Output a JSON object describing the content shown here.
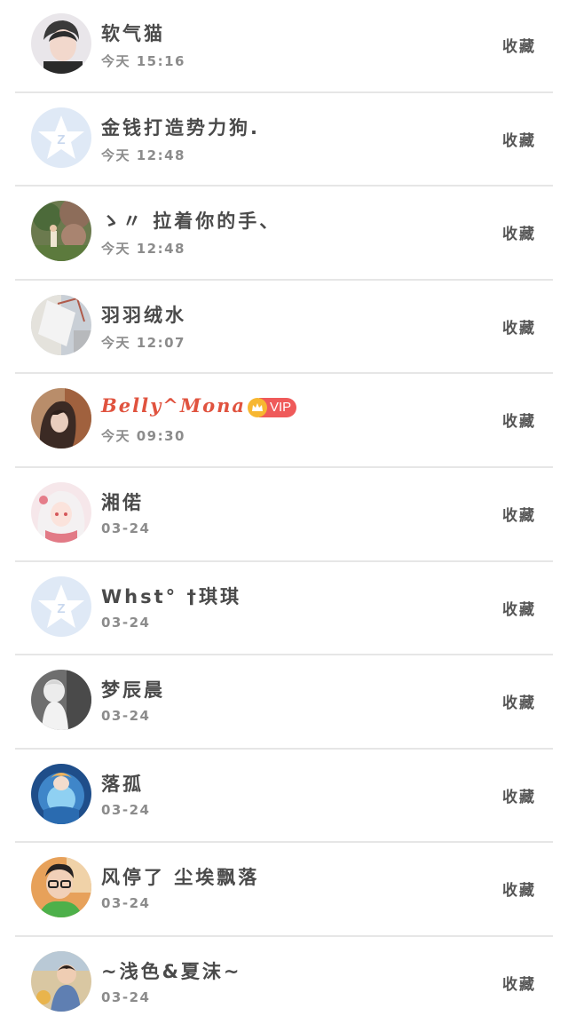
{
  "contacts": [
    {
      "name": "软气猫",
      "time": "今天 15:16",
      "action": "收藏",
      "avatar": "photo-male-portrait",
      "vip": false
    },
    {
      "name": "金钱打造势力狗.",
      "time": "今天 12:48",
      "action": "收藏",
      "avatar": "default-qq-star",
      "vip": false
    },
    {
      "name": "ゝ〃 拉着你的手、",
      "time": "今天 12:48",
      "action": "收藏",
      "avatar": "photo-garden-child",
      "vip": false
    },
    {
      "name": "羽羽绒水",
      "time": "今天 12:07",
      "action": "收藏",
      "avatar": "photo-room-window",
      "vip": false
    },
    {
      "name": "Belly^Mona",
      "time": "今天 09:30",
      "action": "收藏",
      "avatar": "photo-girl-dark-hair",
      "vip": true,
      "vip_label": "VIP"
    },
    {
      "name": "湘偌",
      "time": "03-24",
      "action": "收藏",
      "avatar": "anime-girl-white-hair",
      "vip": false
    },
    {
      "name": "Whst° †琪琪",
      "time": "03-24",
      "action": "收藏",
      "avatar": "default-qq-star",
      "vip": false
    },
    {
      "name": "梦辰晨",
      "time": "03-24",
      "action": "收藏",
      "avatar": "photo-bw-figure",
      "vip": false
    },
    {
      "name": "落孤",
      "time": "03-24",
      "action": "收藏",
      "avatar": "anime-blue-fantasy",
      "vip": false
    },
    {
      "name": "风停了 尘埃飘落",
      "time": "03-24",
      "action": "收藏",
      "avatar": "photo-boy-glasses",
      "vip": false
    },
    {
      "name": "~浅色&夏沫~",
      "time": "03-24",
      "action": "收藏",
      "avatar": "photo-toddler-beach",
      "vip": false
    }
  ],
  "colors": {
    "name": "#4a4a4a",
    "vip_name": "#e0533f",
    "time": "#8c8c8c",
    "action": "#555555",
    "divider": "#e6e6e6",
    "vip_badge": "#ef5a5a",
    "default_avatar_bg": "#dfe9f6"
  }
}
